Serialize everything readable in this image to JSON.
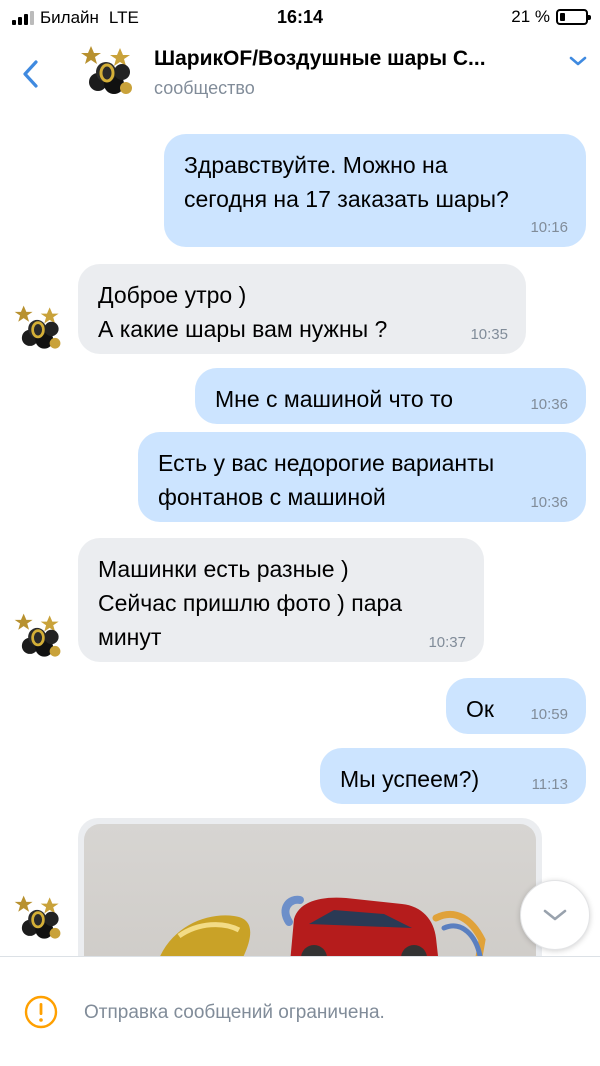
{
  "status_bar": {
    "carrier": "Билайн",
    "network": "LTE",
    "time": "16:14",
    "battery": "21 %",
    "battery_level": 0.21
  },
  "header": {
    "title": "ШарикOF/Воздушные шары С...",
    "subtitle": "сообщество"
  },
  "messages": [
    {
      "dir": "out",
      "text": "Здравствуйте. Можно на\nсегодня на 17 заказать шары?",
      "time": "10:16"
    },
    {
      "dir": "in",
      "text": "Доброе утро )\nА какие шары вам нужны ?",
      "time": "10:35"
    },
    {
      "dir": "out",
      "text": "Мне с машиной что то",
      "time": "10:36"
    },
    {
      "dir": "out",
      "text": "Есть у вас недорогие варианты\nфонтанов с машиной",
      "time": "10:36"
    },
    {
      "dir": "in",
      "text": "Машинки есть разные )\nСейчас пришлю фото ) пара\nминут",
      "time": "10:37"
    },
    {
      "dir": "out",
      "text": "Ок",
      "time": "10:59"
    },
    {
      "dir": "out",
      "text": "Мы успеем?)",
      "time": "11:13"
    }
  ],
  "footer": {
    "notice": "Отправка сообщений ограничена."
  },
  "colors": {
    "accent": "#3f8ae0",
    "outgoing_bubble": "#cce4ff",
    "incoming_bubble": "#ebedf0",
    "secondary_text": "#818c99",
    "warning": "#ffa000"
  },
  "icons": {
    "back": "chevron-left-icon",
    "header_menu": "chevron-down-icon",
    "scroll_down": "chevron-down-icon",
    "notice": "warning-icon"
  }
}
